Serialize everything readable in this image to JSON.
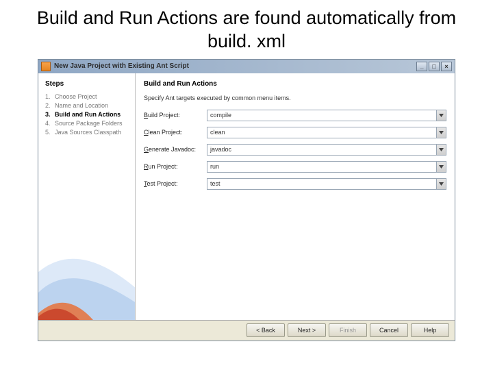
{
  "slide": {
    "title": "Build and Run Actions are found automatically from build. xml"
  },
  "window": {
    "title": "New Java Project with Existing Ant Script",
    "buttons": {
      "min": "_",
      "max": "□",
      "close": "×"
    }
  },
  "sidebar": {
    "heading": "Steps",
    "items": [
      {
        "num": "1.",
        "label": "Choose Project"
      },
      {
        "num": "2.",
        "label": "Name and Location"
      },
      {
        "num": "3.",
        "label": "Build and Run Actions"
      },
      {
        "num": "4.",
        "label": "Source Package Folders"
      },
      {
        "num": "5.",
        "label": "Java Sources Classpath"
      }
    ],
    "current_index": 2
  },
  "main": {
    "heading": "Build and Run Actions",
    "description": "Specify Ant targets executed by common menu items.",
    "fields": [
      {
        "label": "Build Project:",
        "value": "compile"
      },
      {
        "label": "Clean Project:",
        "value": "clean"
      },
      {
        "label": "Generate Javadoc:",
        "value": "javadoc"
      },
      {
        "label": "Run Project:",
        "value": "run"
      },
      {
        "label": "Test Project:",
        "value": "test"
      }
    ]
  },
  "footer": {
    "back": "< Back",
    "next": "Next >",
    "finish": "Finish",
    "cancel": "Cancel",
    "help": "Help"
  }
}
